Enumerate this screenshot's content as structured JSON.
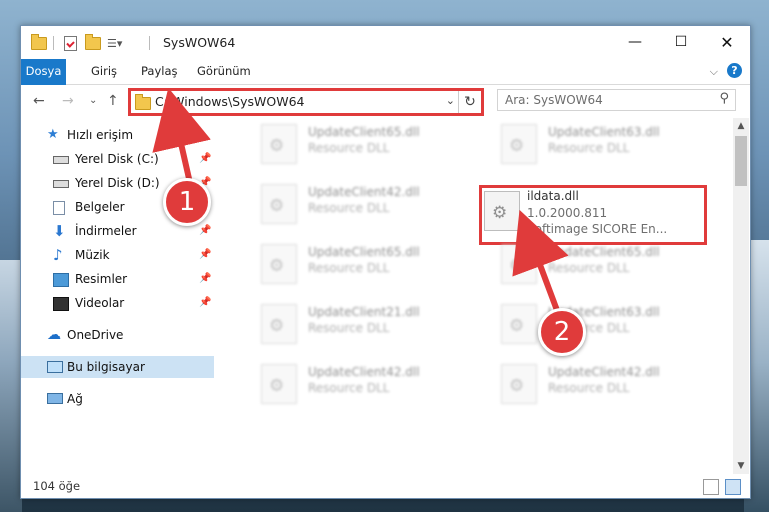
{
  "window": {
    "title": "SysWOW64"
  },
  "ribbon": {
    "tabs": [
      "Dosya",
      "Giriş",
      "Paylaş",
      "Görünüm"
    ]
  },
  "address": {
    "path": "C:\\Windows\\SysWOW64"
  },
  "search": {
    "placeholder": "Ara: SysWOW64"
  },
  "nav": {
    "quick_access": "Hızlı erişim",
    "items": [
      {
        "label": "Yerel Disk (C:)",
        "icon": "drive-icon",
        "pinned": true
      },
      {
        "label": "Yerel Disk (D:)",
        "icon": "drive-icon",
        "pinned": true
      },
      {
        "label": "Belgeler",
        "icon": "documents-icon",
        "pinned": true
      },
      {
        "label": "İndirmeler",
        "icon": "downloads-icon",
        "pinned": true
      },
      {
        "label": "Müzik",
        "icon": "music-icon",
        "pinned": true
      },
      {
        "label": "Resimler",
        "icon": "pictures-icon",
        "pinned": true
      },
      {
        "label": "Videolar",
        "icon": "videos-icon",
        "pinned": true
      }
    ],
    "onedrive": "OneDrive",
    "this_pc": "Bu bilgisayar",
    "network": "Ağ"
  },
  "files": [
    {
      "name": "UpdateClient65.dll",
      "desc": "Resource DLL"
    },
    {
      "name": "UpdateClient63.dll",
      "desc": "Resource DLL"
    },
    {
      "name": "UpdateClient42.dll",
      "desc": "Resource DLL"
    },
    {
      "name": "ildata.dll",
      "version": "1.0.2000.811",
      "desc": "Softimage SICORE En..."
    },
    {
      "name": "UpdateClient65.dll",
      "desc": "Resource DLL"
    },
    {
      "name": "UpdateClient65.dll",
      "desc": "Resource DLL"
    },
    {
      "name": "UpdateClient21.dll",
      "desc": "Resource DLL"
    },
    {
      "name": "UpdateClient63.dll",
      "desc": "Resource DLL"
    },
    {
      "name": "UpdateClient42.dll",
      "desc": "Resource DLL"
    },
    {
      "name": "UpdateClient42.dll",
      "desc": "Resource DLL"
    }
  ],
  "status": {
    "count": "104 öğe"
  },
  "callouts": [
    "1",
    "2"
  ],
  "colors": {
    "accent": "#1979ca",
    "highlight": "#e03b3b",
    "selected": "#cce2f4"
  }
}
